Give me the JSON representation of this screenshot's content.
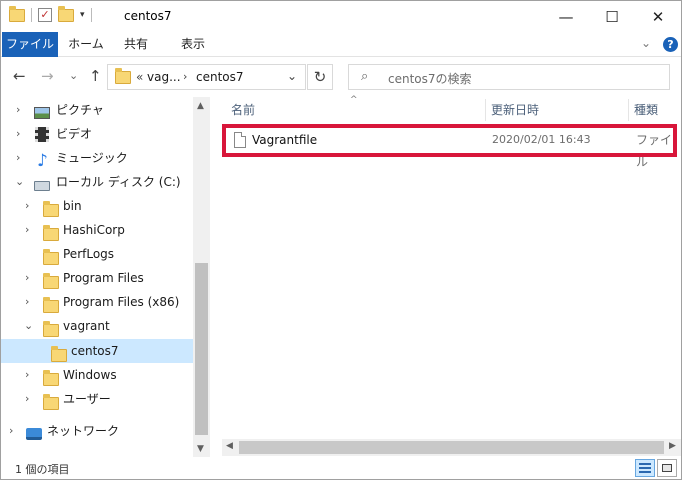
{
  "window": {
    "title": "centos7"
  },
  "controls": {
    "minimize": "—",
    "maximize": "☐",
    "close": "✕"
  },
  "ribbon": {
    "tabs": [
      "ファイル",
      "ホーム",
      "共有",
      "表示"
    ],
    "expand": "⌄",
    "help": "?"
  },
  "nav": {
    "back": "←",
    "forward": "→",
    "recent": "⌄",
    "up": "↑",
    "address": {
      "overflow": "«",
      "segments": [
        "vag...",
        "centos7"
      ],
      "separator": "›"
    },
    "refresh": "↻",
    "search_placeholder": "centos7の検索"
  },
  "sidebar": {
    "items": [
      {
        "label": "ピクチャ",
        "chevron": "›",
        "icon": "pictures-icon"
      },
      {
        "label": "ビデオ",
        "chevron": "›",
        "icon": "videos-icon"
      },
      {
        "label": "ミュージック",
        "chevron": "›",
        "icon": "music-icon"
      },
      {
        "label": "ローカル ディスク (C:)",
        "chevron": "⌄",
        "icon": "drive-icon"
      },
      {
        "label": "bin",
        "chevron": "›",
        "icon": "folder-icon"
      },
      {
        "label": "HashiCorp",
        "chevron": "›",
        "icon": "folder-icon"
      },
      {
        "label": "PerfLogs",
        "chevron": "",
        "icon": "folder-icon"
      },
      {
        "label": "Program Files",
        "chevron": "›",
        "icon": "folder-icon"
      },
      {
        "label": "Program Files (x86)",
        "chevron": "›",
        "icon": "folder-icon"
      },
      {
        "label": "vagrant",
        "chevron": "⌄",
        "icon": "folder-icon"
      },
      {
        "label": "centos7",
        "chevron": "",
        "icon": "folder-icon",
        "selected": true
      },
      {
        "label": "Windows",
        "chevron": "›",
        "icon": "folder-icon"
      },
      {
        "label": "ユーザー",
        "chevron": "›",
        "icon": "folder-icon"
      },
      {
        "label": "ネットワーク",
        "chevron": "›",
        "icon": "network-icon"
      }
    ]
  },
  "columns": {
    "name": "名前",
    "date": "更新日時",
    "type": "種類",
    "sort_indicator": "^"
  },
  "files": [
    {
      "name": "Vagrantfile",
      "date": "2020/02/01 16:43",
      "type": "ファイル"
    }
  ],
  "status": {
    "count": "1 個の項目"
  },
  "colors": {
    "accent": "#1a62b8",
    "selection": "#cce8ff",
    "highlight_border": "#d8163a"
  }
}
